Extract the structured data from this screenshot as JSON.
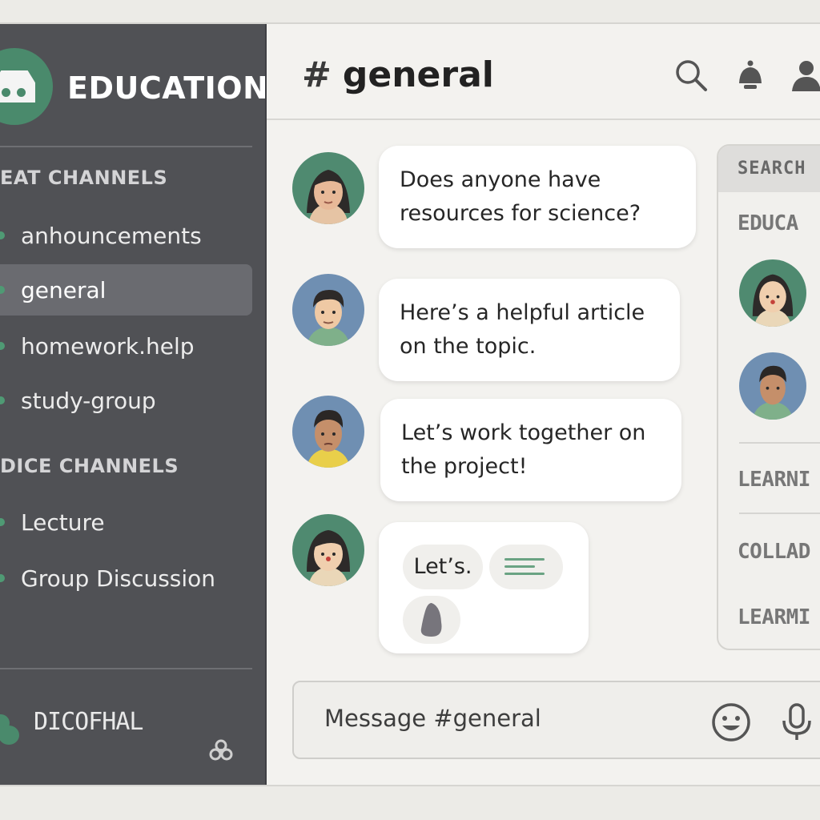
{
  "server": {
    "name": "EDUCATION"
  },
  "sidebar": {
    "categories": [
      {
        "label": "EAT CHANNELS"
      },
      {
        "label": "DICE CHANNELS"
      }
    ],
    "text_channels": [
      {
        "label": "anhouncements"
      },
      {
        "label": "general"
      },
      {
        "label": "homework.help"
      },
      {
        "label": "study-group"
      }
    ],
    "voice_channels": [
      {
        "label": "Lecture"
      },
      {
        "label": "Group Discussion"
      }
    ],
    "user": {
      "name": "DICOFHAL"
    },
    "active_channel": "general"
  },
  "header": {
    "hash": "#",
    "channel": "general",
    "icons": [
      "search-icon",
      "notification-bell-icon",
      "members-icon"
    ]
  },
  "messages": [
    {
      "text": "Does anyone have resources for science?"
    },
    {
      "text": "Here’s a helpful article on the topic."
    },
    {
      "text": "Let’s work together on the project!"
    },
    {
      "chip_text": "Let’s."
    }
  ],
  "right_panel": {
    "header": "SEARCH",
    "sections": [
      "EDUCA",
      "LEARNI",
      "COLLAD",
      "LEARMI"
    ]
  },
  "composer": {
    "placeholder": "Message #general",
    "icons": [
      "emoji-icon",
      "microphone-icon"
    ]
  },
  "colors": {
    "sidebar_bg": "#505155",
    "accent_green": "#4a8a6c",
    "main_bg": "#f3f2ef",
    "bubble_bg": "#ffffff"
  }
}
